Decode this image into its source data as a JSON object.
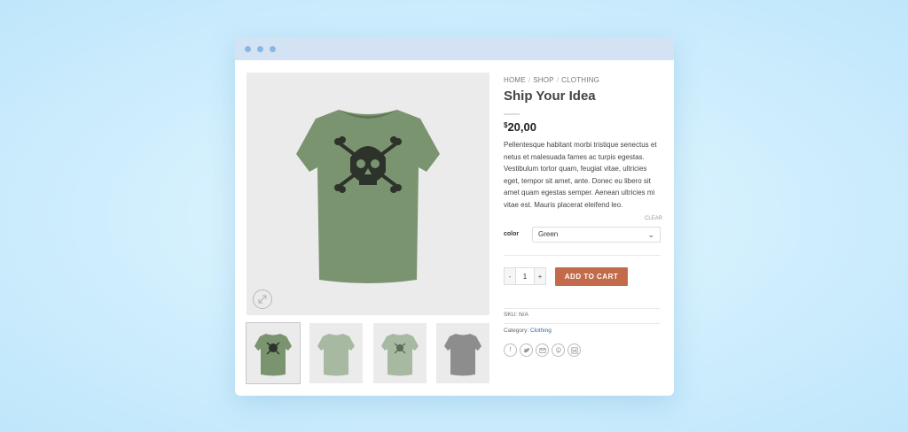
{
  "breadcrumb": {
    "home": "HOME",
    "shop": "SHOP",
    "category": "CLOTHING",
    "separator": "/"
  },
  "product": {
    "title": "Ship Your Idea",
    "price_currency": "$",
    "price_amount": "20,00",
    "description": "Pellentesque habitant morbi tristique senectus et netus et malesuada fames ac turpis egestas. Vestibulum tortor quam, feugiat vitae, ultricies eget, tempor sit amet, ante. Donec eu libero sit amet quam egestas semper. Aenean ultricies mi vitae est. Mauris placerat eleifend leo.",
    "clear_label": "CLEAR",
    "color_label": "color",
    "color_selected": "Green",
    "quantity": "1",
    "minus_label": "-",
    "plus_label": "+",
    "add_to_cart_label": "ADD TO CART",
    "sku_text": "SKU: N/A",
    "category_prefix": "Category:",
    "category_value": "Clothing"
  },
  "icons": {
    "zoom": "zoom-icon",
    "chevron": "chevron-down-icon",
    "facebook": "facebook-icon",
    "twitter": "twitter-icon",
    "email": "email-icon",
    "pinterest": "pinterest-icon",
    "linkedin": "linkedin-icon"
  },
  "colors": {
    "accent": "#c36a4a",
    "titlebar": "#d3e3f3",
    "shirt_green": "#7a9470",
    "shirt_light_green": "#a7b9a0",
    "shirt_grey": "#8d8d8d"
  }
}
